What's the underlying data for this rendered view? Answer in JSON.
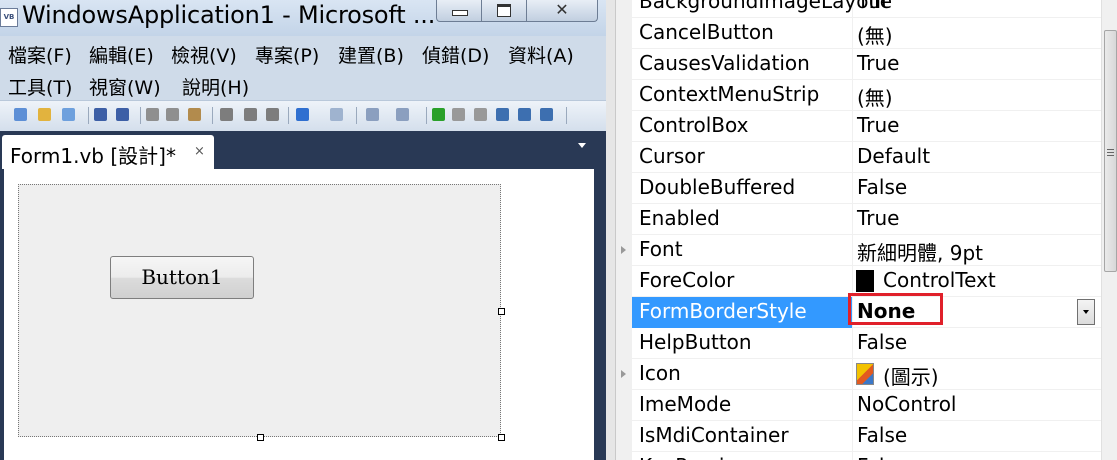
{
  "window": {
    "title": "WindowsApplication1 - Microsoft ...",
    "app_icon_text": "VB",
    "close_glyph": "✕"
  },
  "menus": [
    "檔案(F)",
    "編輯(E)",
    "檢視(V)",
    "專案(P)",
    "建置(B)",
    "偵錯(D)",
    "資料(A)",
    "工具(T)",
    "視窗(W)",
    "說明(H)"
  ],
  "toolbar": {
    "icons": [
      "new-project-icon",
      "open-icon",
      "add-item-icon",
      "save-icon",
      "save-all-icon",
      "cut-icon",
      "copy-icon",
      "paste-icon",
      "find-icon",
      "comment-icon",
      "uncomment-icon",
      "undo-icon",
      "redo-icon",
      "navigate-backward-icon",
      "navigate-forward-icon",
      "start-icon",
      "pause-icon",
      "stop-icon",
      "step-into-icon",
      "step-over-icon",
      "step-out-icon"
    ]
  },
  "document": {
    "tab_label": "Form1.vb [設計]*",
    "tab_close": "×",
    "button_text": "Button1"
  },
  "properties": {
    "rows": [
      {
        "name": "BackgroundImageLayout",
        "value": "Tile"
      },
      {
        "name": "CancelButton",
        "value": "(無)"
      },
      {
        "name": "CausesValidation",
        "value": "True"
      },
      {
        "name": "ContextMenuStrip",
        "value": "(無)"
      },
      {
        "name": "ControlBox",
        "value": "True"
      },
      {
        "name": "Cursor",
        "value": "Default"
      },
      {
        "name": "DoubleBuffered",
        "value": "False"
      },
      {
        "name": "Enabled",
        "value": "True"
      },
      {
        "name": "Font",
        "value": "新細明體, 9pt"
      },
      {
        "name": "ForeColor",
        "value": "ControlText"
      },
      {
        "name": "FormBorderStyle",
        "value": "None"
      },
      {
        "name": "HelpButton",
        "value": "False"
      },
      {
        "name": "Icon",
        "value": "(圖示)"
      },
      {
        "name": "ImeMode",
        "value": "NoControl"
      },
      {
        "name": "IsMdiContainer",
        "value": "False"
      },
      {
        "name": "KeyPreview",
        "value": "False"
      }
    ],
    "selected": "FormBorderStyle",
    "highlight_color": "#3399ff",
    "annotation_color": "#e0202a"
  }
}
